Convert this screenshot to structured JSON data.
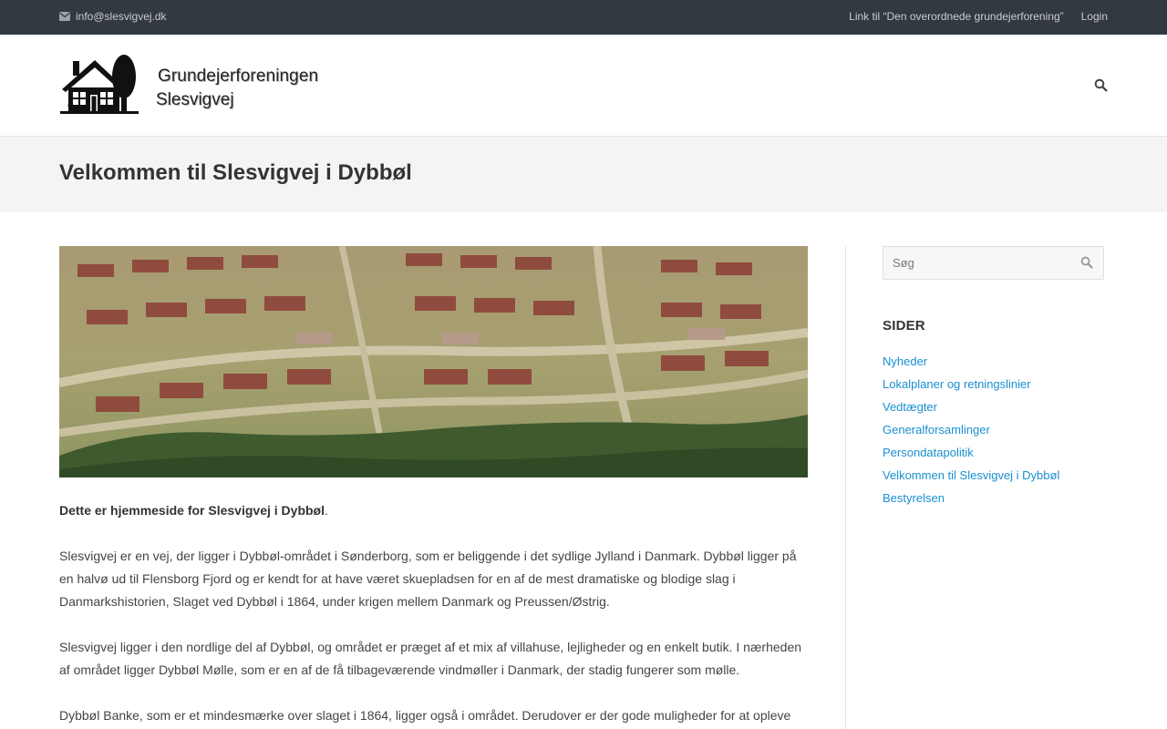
{
  "topbar": {
    "email": "info@slesvigvej.dk",
    "links": [
      "Link til “Den overordnede grundejerforening”",
      "Login"
    ]
  },
  "header": {
    "logo_line1": "Grundejerforeningen",
    "logo_line2": "Slesvigvej",
    "icons": {
      "email": "envelope-icon",
      "search": "search-icon",
      "logo": "house-tree-logo"
    }
  },
  "page": {
    "title": "Velkommen til Slesvigvej i Dybbøl"
  },
  "content": {
    "intro_bold": "Dette er hjemmeside for Slesvigvej i Dybbøl",
    "intro_end": ".",
    "paragraphs": [
      "Slesvigvej er en vej, der ligger i Dybbøl-området i Sønderborg, som er beliggende i det sydlige Jylland i Danmark. Dybbøl ligger på en halvø ud til Flensborg Fjord og er kendt for at have været skuepladsen for en af de mest dramatiske og blodige slag i Danmarkshistorien, Slaget ved Dybbøl i 1864, under krigen mellem Danmark og Preussen/Østrig.",
      "Slesvigvej ligger i den nordlige del af Dybbøl, og området er præget af et mix af villahuse, lejligheder og en enkelt butik. I nærheden af området ligger Dybbøl Mølle, som er en af de få tilbageværende vindmøller i Danmark, der stadig fungerer som mølle.",
      "Dybbøl Banke, som er et mindesmærke over slaget i 1864, ligger også i området. Derudover er der gode muligheder for at opleve"
    ]
  },
  "sidebar": {
    "search_placeholder": "Søg",
    "title": "SIDER",
    "items": [
      "Nyheder",
      "Lokalplaner og retningslinier",
      "Vedtægter",
      "Generalforsamlinger",
      "Persondatapolitik",
      "Velkommen til Slesvigvej i Dybbøl",
      "Bestyrelsen"
    ]
  },
  "colors": {
    "topbar_bg": "#333940",
    "link": "#1a8fd1",
    "title_band": "#f4f4f4"
  }
}
